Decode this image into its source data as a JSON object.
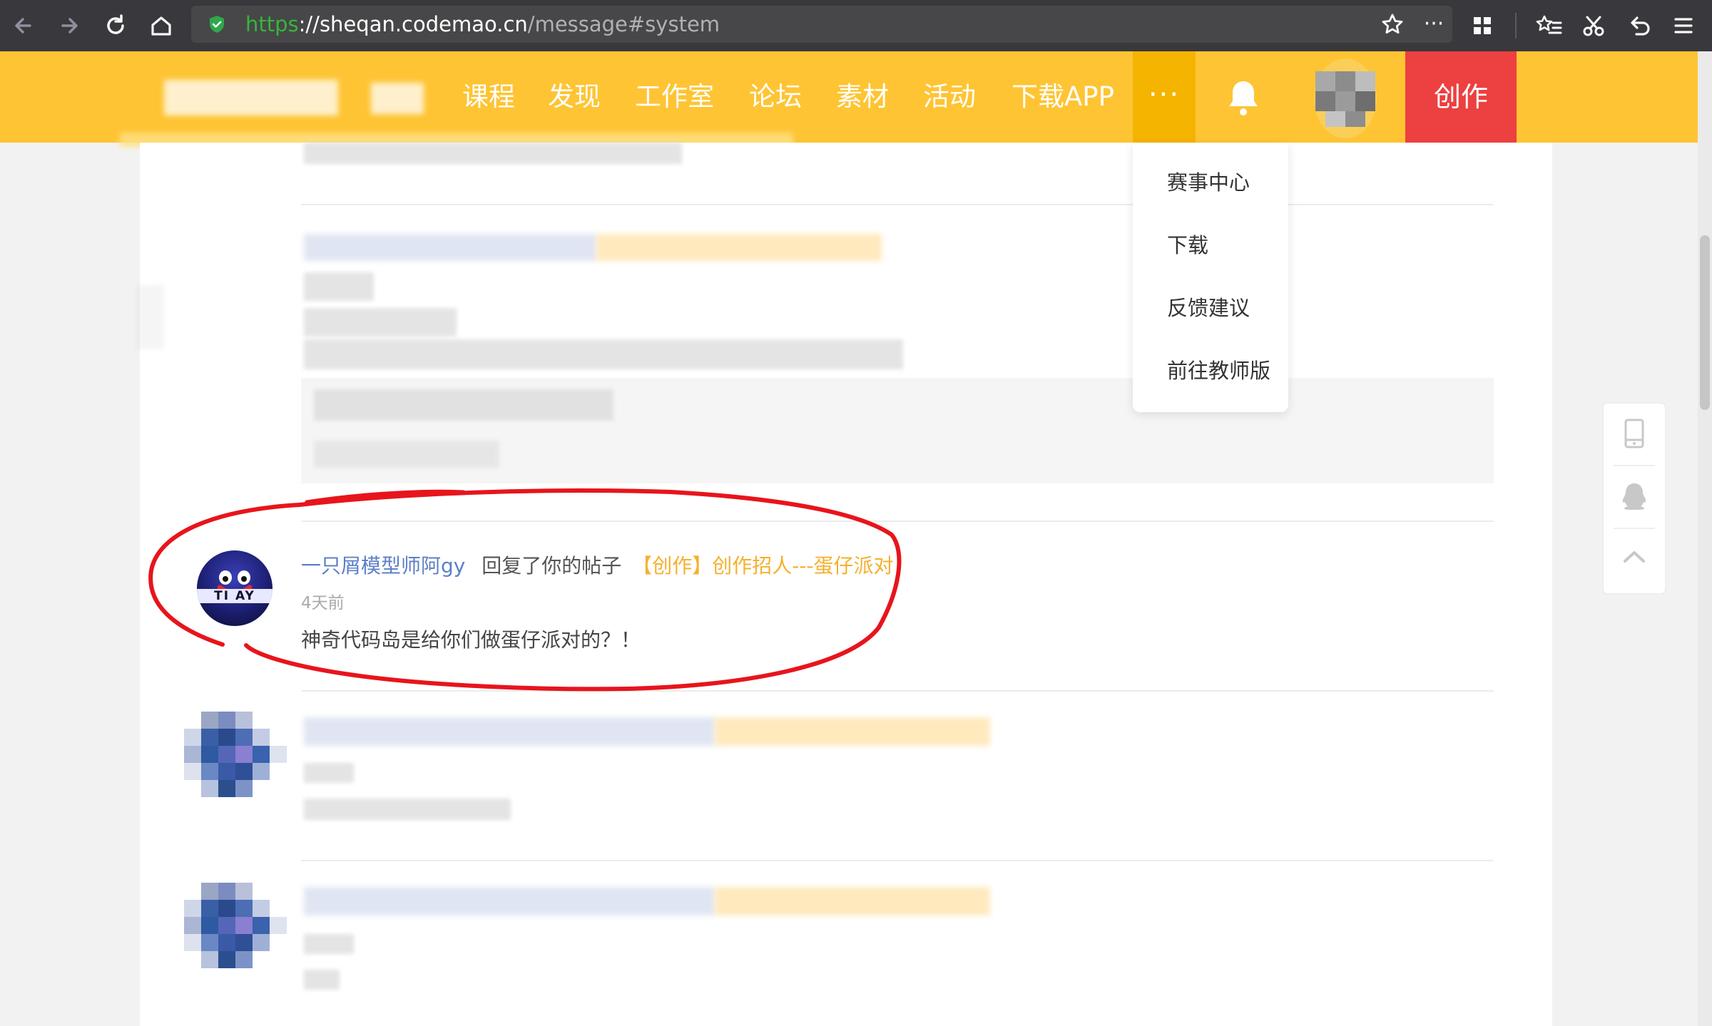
{
  "browser": {
    "url_scheme": "https",
    "url_host": "://sheqan.codemao.cn",
    "url_path": "/message#system",
    "back_label": "←",
    "forward_label": "→",
    "reload_label": "↻",
    "home_label": "⌂",
    "star_label": "☆",
    "more_label": "···",
    "extensions_label": "▦",
    "bookmarks_label": "☆",
    "screenshot_label": "✂",
    "undo_label": "↶",
    "menu_label": "☰"
  },
  "header": {
    "nav": [
      "课程",
      "发现",
      "工作室",
      "论坛",
      "素材",
      "活动",
      "下载APP"
    ],
    "more_label": "···",
    "create_label": "创作"
  },
  "dropdown": {
    "items": [
      "赛事中心",
      "下载",
      "反馈建议",
      "前往教师版"
    ]
  },
  "message": {
    "user": "一只屑模型师阿gy",
    "action": "回复了你的帖子",
    "post": "【创作】创作招人---蛋仔派对",
    "time": "4天前",
    "text": "神奇代码岛是给你们做蛋仔派对的？！",
    "avatar_text": "TI   AY"
  },
  "colors": {
    "header_bg": "#fec433",
    "more_bg": "#f5b400",
    "create_bg": "#ec4041",
    "user_link": "#5c7fc7",
    "post_link": "#f5b02c",
    "annotation": "#e8141c"
  }
}
